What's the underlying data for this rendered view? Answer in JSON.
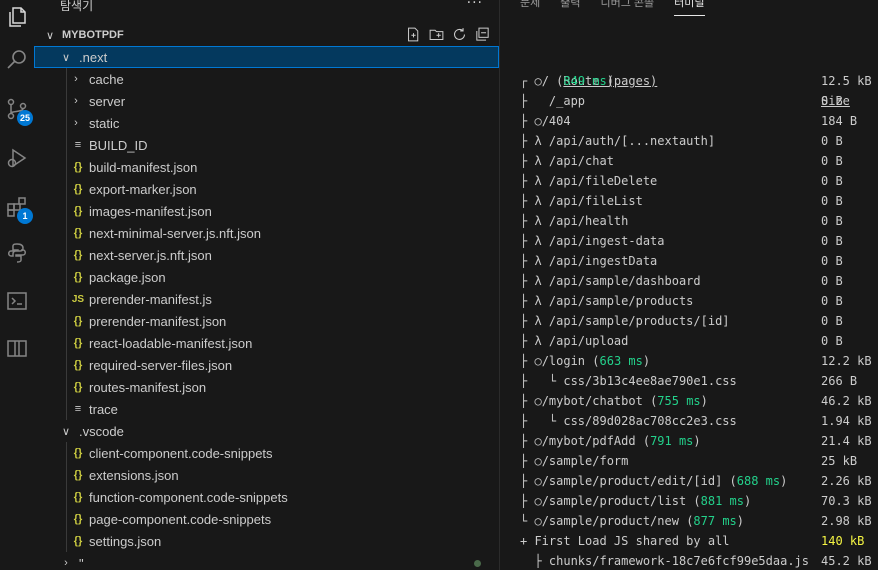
{
  "explorer": {
    "title": "탐색기",
    "more_label": "···",
    "project": "MYBOTPDF"
  },
  "activity": {
    "scm_badge": "25",
    "ext_badge": "1"
  },
  "tree": [
    {
      "label": ".next",
      "kind": "folder-open",
      "depth": 0
    },
    {
      "label": "cache",
      "kind": "folder",
      "depth": 1
    },
    {
      "label": "server",
      "kind": "folder",
      "depth": 1
    },
    {
      "label": "static",
      "kind": "folder",
      "depth": 1
    },
    {
      "label": "BUILD_ID",
      "kind": "txt",
      "depth": 1
    },
    {
      "label": "build-manifest.json",
      "kind": "json",
      "depth": 1
    },
    {
      "label": "export-marker.json",
      "kind": "json",
      "depth": 1
    },
    {
      "label": "images-manifest.json",
      "kind": "json",
      "depth": 1
    },
    {
      "label": "next-minimal-server.js.nft.json",
      "kind": "json",
      "depth": 1
    },
    {
      "label": "next-server.js.nft.json",
      "kind": "json",
      "depth": 1
    },
    {
      "label": "package.json",
      "kind": "json",
      "depth": 1
    },
    {
      "label": "prerender-manifest.js",
      "kind": "js",
      "depth": 1
    },
    {
      "label": "prerender-manifest.json",
      "kind": "json",
      "depth": 1
    },
    {
      "label": "react-loadable-manifest.json",
      "kind": "json",
      "depth": 1
    },
    {
      "label": "required-server-files.json",
      "kind": "json",
      "depth": 1
    },
    {
      "label": "routes-manifest.json",
      "kind": "json",
      "depth": 1
    },
    {
      "label": "trace",
      "kind": "txt",
      "depth": 1
    },
    {
      "label": ".vscode",
      "kind": "folder-open",
      "depth": 0
    },
    {
      "label": "client-component.code-snippets",
      "kind": "json",
      "depth": 1
    },
    {
      "label": "extensions.json",
      "kind": "json",
      "depth": 1
    },
    {
      "label": "function-component.code-snippets",
      "kind": "json",
      "depth": 1
    },
    {
      "label": "page-component.code-snippets",
      "kind": "json",
      "depth": 1
    },
    {
      "label": "settings.json",
      "kind": "json",
      "depth": 1
    },
    {
      "label": "\"",
      "kind": "folder",
      "depth": 0
    }
  ],
  "panel": {
    "tabs": [
      "문제",
      "출력",
      "디버그 콘솔",
      "터미널"
    ],
    "active_tab": "터미널"
  },
  "terminal": {
    "header": {
      "route": "Route (pages)",
      "size": "Size"
    },
    "lines": [
      {
        "prefix": "┌ ○",
        "path": "/",
        "ms": "849 ms",
        "size": "12.5 kB"
      },
      {
        "prefix": "├   ",
        "path": "/_app",
        "ms": "",
        "size": "0 B"
      },
      {
        "prefix": "├ ○",
        "path": "/404",
        "ms": "",
        "size": "184 B"
      },
      {
        "prefix": "├ λ",
        "path": " /api/auth/[...nextauth]",
        "ms": "",
        "size": "0 B"
      },
      {
        "prefix": "├ λ",
        "path": " /api/chat",
        "ms": "",
        "size": "0 B"
      },
      {
        "prefix": "├ λ",
        "path": " /api/fileDelete",
        "ms": "",
        "size": "0 B"
      },
      {
        "prefix": "├ λ",
        "path": " /api/fileList",
        "ms": "",
        "size": "0 B"
      },
      {
        "prefix": "├ λ",
        "path": " /api/health",
        "ms": "",
        "size": "0 B"
      },
      {
        "prefix": "├ λ",
        "path": " /api/ingest-data",
        "ms": "",
        "size": "0 B"
      },
      {
        "prefix": "├ λ",
        "path": " /api/ingestData",
        "ms": "",
        "size": "0 B"
      },
      {
        "prefix": "├ λ",
        "path": " /api/sample/dashboard",
        "ms": "",
        "size": "0 B"
      },
      {
        "prefix": "├ λ",
        "path": " /api/sample/products",
        "ms": "",
        "size": "0 B"
      },
      {
        "prefix": "├ λ",
        "path": " /api/sample/products/[id]",
        "ms": "",
        "size": "0 B"
      },
      {
        "prefix": "├ λ",
        "path": " /api/upload",
        "ms": "",
        "size": "0 B"
      },
      {
        "prefix": "├ ○",
        "path": "/login",
        "ms": "663 ms",
        "size": "12.2 kB"
      },
      {
        "prefix": "├   └ ",
        "path": "css/3b13c4ee8ae790e1.css",
        "ms": "",
        "size": "266 B"
      },
      {
        "prefix": "├ ○",
        "path": "/mybot/chatbot",
        "ms": "755 ms",
        "size": "46.2 kB"
      },
      {
        "prefix": "├   └ ",
        "path": "css/89d028ac708cc2e3.css",
        "ms": "",
        "size": "1.94 kB"
      },
      {
        "prefix": "├ ○",
        "path": "/mybot/pdfAdd",
        "ms": "791 ms",
        "size": "21.4 kB"
      },
      {
        "prefix": "├ ○",
        "path": "/sample/form",
        "ms": "",
        "size": "25 kB"
      },
      {
        "prefix": "├ ○",
        "path": "/sample/product/edit/[id]",
        "ms": "688 ms",
        "size": "2.26 kB"
      },
      {
        "prefix": "├ ○",
        "path": "/sample/product/list",
        "ms": "881 ms",
        "size": "70.3 kB"
      },
      {
        "prefix": "└ ○",
        "path": "/sample/product/new",
        "ms": "877 ms",
        "size": "2.98 kB"
      },
      {
        "prefix": "+ ",
        "path": "First Load JS shared by all",
        "ms": "",
        "size": "140 kB",
        "size_color": "yellow"
      },
      {
        "prefix": "  ├ ",
        "path": "chunks/framework-18c7e6fcf99e5daa.js",
        "ms": "",
        "size": "45.2 kB"
      }
    ]
  }
}
